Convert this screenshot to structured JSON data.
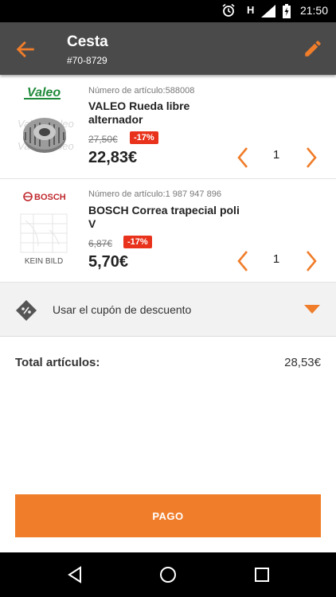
{
  "status_bar": {
    "time": "21:50",
    "network": "H"
  },
  "header": {
    "title": "Cesta",
    "order_id": "#70-8729"
  },
  "items": [
    {
      "brand_logo": "Valeo",
      "article_number": "Número de artículo:588008",
      "name": "VALEO Rueda libre alternador",
      "old_price": "27,50€",
      "discount": "-17%",
      "price": "22,83€",
      "quantity": "1"
    },
    {
      "brand_logo": "BOSCH",
      "image_caption": "KEIN BILD",
      "article_number": "Número de artículo:1 987 947 896",
      "name": "BOSCH Correa trapecial poli V",
      "old_price": "6,87€",
      "discount": "-17%",
      "price": "5,70€",
      "quantity": "1"
    }
  ],
  "coupon": {
    "label": "Usar el cupón de descuento"
  },
  "totals": {
    "label": "Total artículos:",
    "value": "28,53€"
  },
  "pay_button": {
    "label": "PAGO"
  },
  "colors": {
    "accent": "#f07d2a",
    "appbar": "#4a4a4a",
    "discount": "#e8321c"
  },
  "icons": [
    "back-arrow-icon",
    "edit-pencil-icon",
    "coupon-tag-icon",
    "chevron-left-icon",
    "chevron-right-icon",
    "dropdown-caret-icon"
  ]
}
